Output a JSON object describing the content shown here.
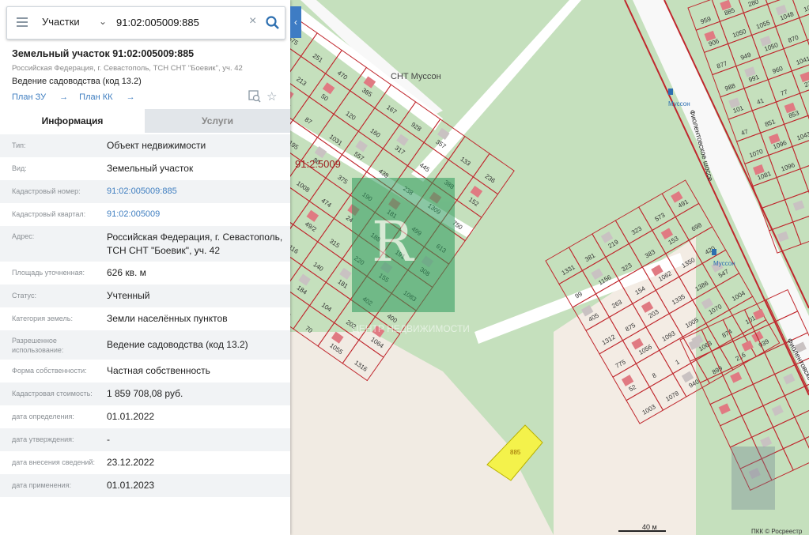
{
  "search": {
    "type_label": "Участки",
    "query": "91:02:005009:885"
  },
  "parcel": {
    "title": "Земельный участок 91:02:005009:885",
    "address": "Российская Федерация, г. Севастополь, ТСН СНТ \"Боевик\", уч. 42",
    "usage": "Ведение садоводства (код 13.2)",
    "link_zu": "План ЗУ",
    "link_kk": "План КК"
  },
  "tabs": [
    {
      "label": "Информация"
    },
    {
      "label": "Услуги"
    }
  ],
  "rows": [
    {
      "label": "Тип:",
      "value": "Объект недвижимости"
    },
    {
      "label": "Вид:",
      "value": "Земельный участок"
    },
    {
      "label": "Кадастровый номер:",
      "value": "91:02:005009:885"
    },
    {
      "label": "Кадастровый квартал:",
      "value": "91:02:005009"
    },
    {
      "label": "Адрес:",
      "value": "Российская Федерация, г. Севастополь, ТСН СНТ \"Боевик\", уч. 42"
    },
    {
      "label": "Площадь уточненная:",
      "value": "626 кв. м"
    },
    {
      "label": "Статус:",
      "value": "Учтенный"
    },
    {
      "label": "Категория земель:",
      "value": "Земли населённых пунктов"
    },
    {
      "label": "Разрешенное использование:",
      "label2": "использование:",
      "value": "Ведение садоводства (код 13.2)"
    },
    {
      "label": "Форма собственности:",
      "value": "Частная собственность"
    },
    {
      "label": "Кадастровая стоимость:",
      "value": "1 859 708,08 руб."
    },
    {
      "label": "дата определения:",
      "value": "01.01.2022"
    },
    {
      "label": "дата утверждения:",
      "value": "-"
    },
    {
      "label": "дата внесения сведений:",
      "value": "23.12.2022"
    },
    {
      "label": "дата применения:",
      "value": "01.01.2023"
    }
  ],
  "map": {
    "quarter_label": "91:2:5009",
    "snt_label": "СНТ Муссон",
    "selected_parcel": "885",
    "road_label": "Фиолентовское шоссе",
    "bus_stop": "Муссон",
    "scale": "40 м",
    "copyright": "ПКК © Росреестр",
    "watermark_text": "ЦЕНТР НЕДВИЖИМОСТИ",
    "parcel_numbers": [
      "575",
      "251",
      "470",
      "385",
      "167",
      "928",
      "357",
      "133",
      "236",
      "141",
      "213",
      "50",
      "120",
      "160",
      "317",
      "445",
      "388",
      "152",
      "447",
      "277",
      "87",
      "1031",
      "557",
      "438",
      "238",
      "1309",
      "750",
      "389",
      "205",
      "195",
      "80",
      "375",
      "190",
      "181",
      "499",
      "613",
      "365",
      "197",
      "1322",
      "1008",
      "474",
      "24",
      "188",
      "191",
      "308",
      "531",
      "384",
      "1139",
      "14",
      "49/2",
      "315",
      "220",
      "155",
      "1083",
      "13",
      "199",
      "425",
      "128",
      "116",
      "140",
      "181",
      "402",
      "400",
      "275",
      "71",
      "254",
      "258",
      "58",
      "184",
      "104",
      "202",
      "1064",
      "368",
      "292",
      "297",
      "273",
      "329",
      "288",
      "70",
      "1055",
      "1316",
      "1331",
      "381",
      "219",
      "323",
      "573",
      "491",
      "99",
      "1156",
      "323",
      "383",
      "153",
      "698",
      "405",
      "263",
      "154",
      "1062",
      "1350",
      "420",
      "1312",
      "875",
      "203",
      "1335",
      "1386",
      "547",
      "775",
      "1056",
      "1093",
      "1005",
      "1070",
      "1004",
      "52",
      "8",
      "1",
      "1063",
      "874",
      "1019",
      "1003",
      "1078",
      "940",
      "899",
      "216",
      "939",
      "959",
      "885",
      "280",
      "1378",
      "907",
      "906",
      "1050",
      "1055",
      "1048",
      "1046",
      "877",
      "949",
      "1050",
      "870",
      "1306",
      "988",
      "991",
      "960",
      "1041",
      "52",
      "101",
      "41",
      "77",
      "236",
      "240",
      "47",
      "851",
      "853",
      "995",
      "995",
      "1070",
      "1096",
      "1043",
      "46",
      "1073",
      "1081",
      "1096"
    ]
  },
  "colors": {
    "map_green": "#c5e0bd",
    "map_beige": "#f3ece4",
    "parcel_border": "#c0272d",
    "selected_fill": "#f4f24b",
    "link_blue": "#3f7ec0"
  }
}
